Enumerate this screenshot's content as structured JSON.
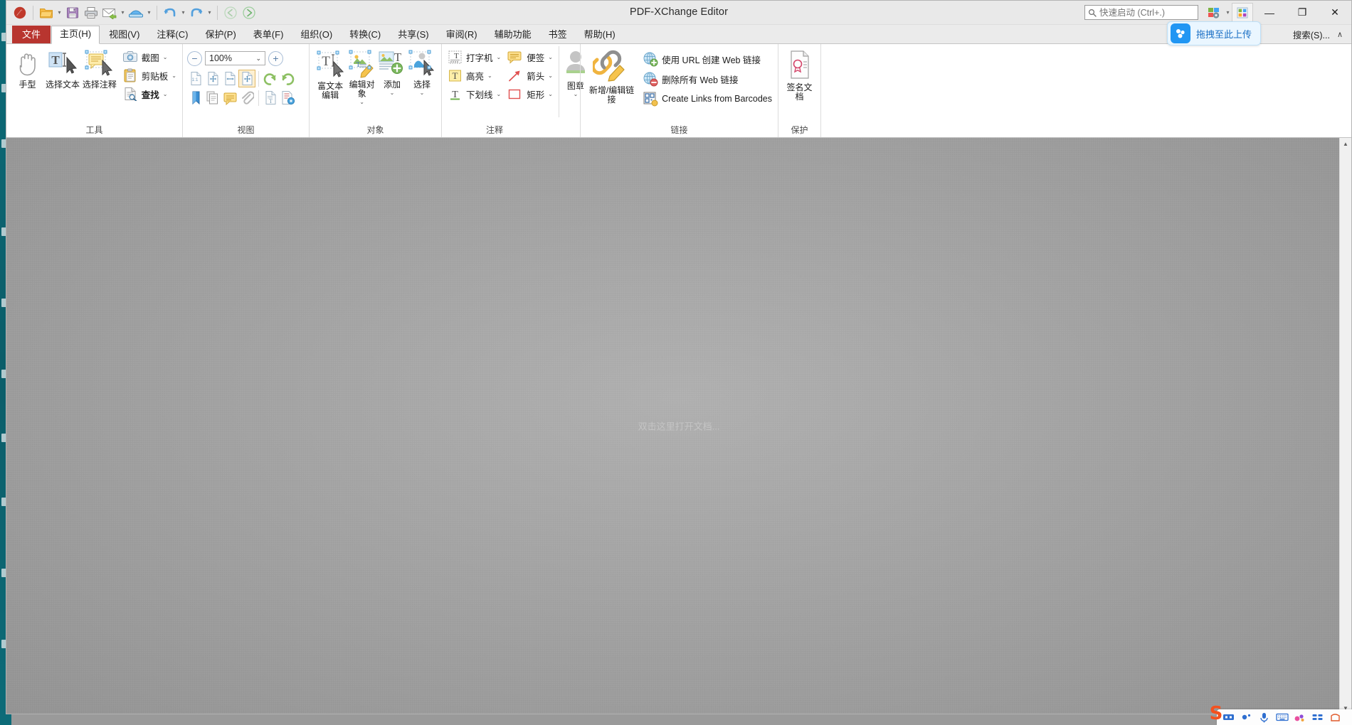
{
  "window": {
    "title": "PDF-XChange Editor",
    "minimize_label": "—",
    "maximize_label": "❐",
    "close_label": "✕"
  },
  "quick_access": {
    "items": [
      {
        "name": "pdf-xchange-logo-icon",
        "label": "PDF-XChange Editor"
      },
      {
        "name": "open-file-icon",
        "label": "打开"
      },
      {
        "name": "save-icon",
        "label": "保存"
      },
      {
        "name": "print-icon",
        "label": "打印"
      },
      {
        "name": "email-icon",
        "label": "电子邮件"
      },
      {
        "name": "scan-icon",
        "label": "扫描"
      },
      {
        "name": "undo-icon",
        "label": "撤销"
      },
      {
        "name": "redo-icon",
        "label": "恢复"
      },
      {
        "name": "back-icon",
        "label": "后退"
      },
      {
        "name": "forward-icon",
        "label": "前进"
      }
    ]
  },
  "search": {
    "placeholder": "快速启动 (Ctrl+.)",
    "value": "",
    "icon": "search-icon"
  },
  "tabs": {
    "file_label": "文件",
    "items": [
      {
        "label": "主页(H)",
        "active": true
      },
      {
        "label": "视图(V)",
        "active": false
      },
      {
        "label": "注释(C)",
        "active": false
      },
      {
        "label": "保护(P)",
        "active": false
      },
      {
        "label": "表单(F)",
        "active": false
      },
      {
        "label": "组织(O)",
        "active": false
      },
      {
        "label": "转换(C)",
        "active": false
      },
      {
        "label": "共享(S)",
        "active": false
      },
      {
        "label": "审阅(R)",
        "active": false
      },
      {
        "label": "辅助功能",
        "active": false
      },
      {
        "label": "书签",
        "active": false
      },
      {
        "label": "帮助(H)",
        "active": false
      }
    ],
    "right_text": "搜索(S)...",
    "collapse_caret": "∧"
  },
  "ribbon": {
    "groups": [
      {
        "name": "tools",
        "title": "工具",
        "big_buttons": [
          {
            "label": "手型",
            "icon": "hand-tool-icon"
          },
          {
            "label": "选择文本",
            "icon": "select-text-icon"
          },
          {
            "label": "选择注释",
            "icon": "select-comment-icon"
          }
        ],
        "small_buttons": [
          {
            "label": "截图",
            "icon": "camera-icon",
            "caret": "⌄"
          },
          {
            "label": "剪贴板",
            "icon": "clipboard-icon",
            "caret": "⌄"
          },
          {
            "label": "查找",
            "icon": "find-icon",
            "caret": "⌄"
          }
        ]
      },
      {
        "name": "view",
        "title": "视图",
        "zoom": {
          "minus_label": "−",
          "plus_label": "+",
          "value": "100%",
          "caret": "⌄"
        },
        "icon_row_1": [
          {
            "name": "single-page-icon",
            "selected": false
          },
          {
            "name": "fit-page-icon",
            "selected": false
          },
          {
            "name": "fit-width-icon",
            "selected": false
          },
          {
            "name": "fit-visible-icon",
            "selected": true
          },
          {
            "name": "rotate-left-icon",
            "selected": false
          },
          {
            "name": "rotate-right-icon",
            "selected": false
          }
        ],
        "icon_row_2": [
          {
            "name": "bookmarks-pane-icon",
            "selected": false
          },
          {
            "name": "thumbnails-pane-icon",
            "selected": false
          },
          {
            "name": "comments-pane-icon",
            "selected": false
          },
          {
            "name": "attachments-pane-icon",
            "selected": false
          },
          {
            "name": "content-pane-icon",
            "selected": false
          },
          {
            "name": "properties-pane-icon",
            "selected": false
          }
        ]
      },
      {
        "name": "object",
        "title": "对象",
        "big_buttons": [
          {
            "label": "富文本编辑",
            "icon": "rich-text-edit-icon",
            "caret": ""
          },
          {
            "label": "编辑对象",
            "icon": "edit-object-icon",
            "caret": "⌄"
          },
          {
            "label": "添加",
            "icon": "add-object-icon",
            "caret": "⌄"
          },
          {
            "label": "选择",
            "icon": "select-object-icon",
            "caret": "⌄"
          }
        ]
      },
      {
        "name": "comment",
        "title": "注释",
        "small_buttons": [
          {
            "label": "打字机",
            "icon": "typewriter-icon",
            "caret": "⌄"
          },
          {
            "label": "便签",
            "icon": "sticky-note-icon",
            "caret": "⌄"
          },
          {
            "label": "高亮",
            "icon": "highlight-icon",
            "caret": "⌄"
          },
          {
            "label": "箭头",
            "icon": "arrow-icon",
            "caret": "⌄"
          },
          {
            "label": "下划线",
            "icon": "underline-icon",
            "caret": "⌄"
          },
          {
            "label": "矩形",
            "icon": "rectangle-icon",
            "caret": "⌄"
          }
        ],
        "stamp": {
          "label": "图章",
          "icon": "stamp-icon",
          "caret": "⌄"
        }
      },
      {
        "name": "links",
        "title": "链接",
        "big_button": {
          "label": "新增/编辑链接",
          "icon": "edit-link-icon"
        },
        "small_buttons": [
          {
            "label": "使用 URL 创建 Web 链接",
            "icon": "add-web-link-icon"
          },
          {
            "label": "删除所有 Web 链接",
            "icon": "remove-web-link-icon"
          },
          {
            "label": "Create Links from Barcodes",
            "icon": "barcode-link-icon"
          }
        ]
      },
      {
        "name": "protect",
        "title": "保护",
        "big_button": {
          "label": "签名文档",
          "icon": "sign-document-icon"
        }
      }
    ]
  },
  "workspace": {
    "hint": "双击这里打开文档...",
    "scroll_up": "▲",
    "scroll_down": "▼"
  },
  "upload_pill": {
    "text": "拖拽至此上传",
    "icon": "baidu-netdisk-icon"
  },
  "ime": {
    "logo": "S",
    "items": [
      {
        "name": "ime-keyboard-toggle-icon"
      },
      {
        "name": "ime-mode-icon"
      },
      {
        "name": "ime-voice-icon"
      },
      {
        "name": "ime-softkeyboard-icon"
      },
      {
        "name": "ime-emoji-icon"
      },
      {
        "name": "ime-toolbox-icon"
      },
      {
        "name": "ime-skin-icon"
      }
    ]
  },
  "colors": {
    "file_tab": "#b8352f",
    "accent": "#2196f3",
    "taskbar": "#0d6b78",
    "selection": "#fdf0d2"
  }
}
